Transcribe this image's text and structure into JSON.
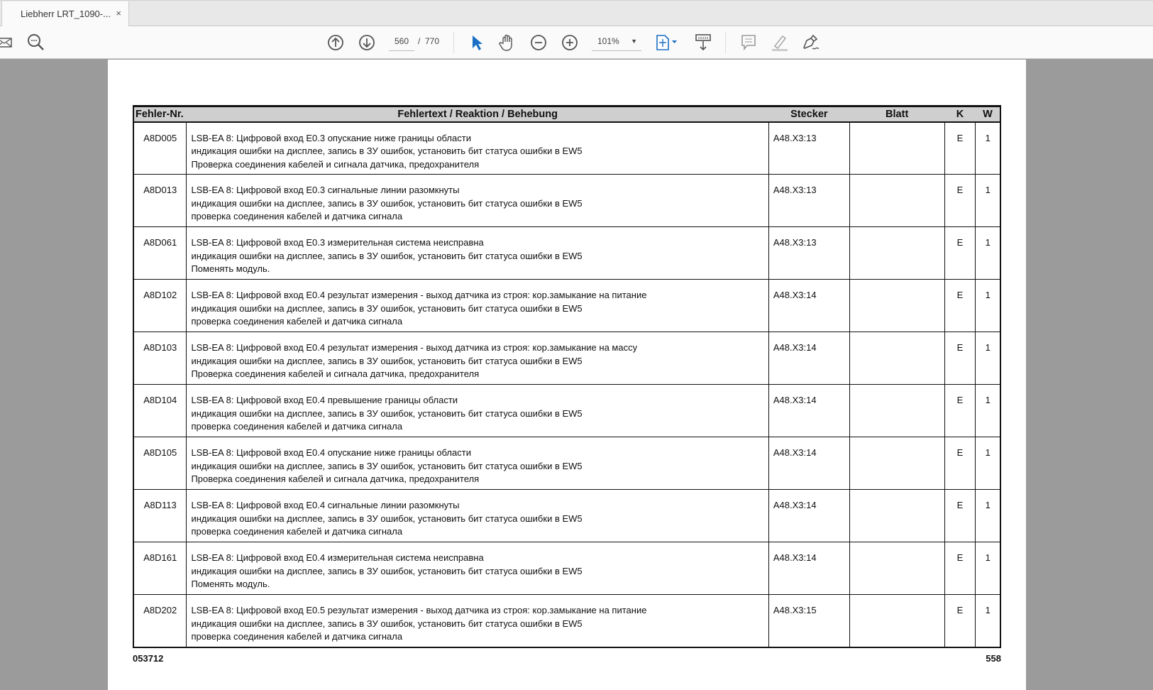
{
  "tab": {
    "title": "Liebherr LRT_1090-...",
    "close": "×"
  },
  "toolbar": {
    "page_current": "560",
    "page_sep": "/",
    "page_total": "770",
    "zoom": "101%",
    "icons": [
      "mail-icon",
      "search-icon",
      "page-up-icon",
      "page-down-icon",
      "select-cursor-icon",
      "hand-icon",
      "zoom-out-icon",
      "zoom-in-icon",
      "fit-page-icon",
      "scroll-mode-icon",
      "comment-icon",
      "highlight-icon",
      "sign-icon"
    ],
    "accent": "#1a6fc4"
  },
  "table": {
    "headers": [
      "Fehler-Nr.",
      "Fehlertext / Reaktion / Behebung",
      "Stecker",
      "Blatt",
      "K",
      "W"
    ],
    "rows": [
      {
        "code": "A8D005",
        "lines": [
          "LSB-EA 8: Цифровой вход E0.3 опускание ниже границы области",
          "индикация ошибки на дисплее, запись в ЗУ ошибок, установить бит статуса ошибки в EW5",
          "Проверка соединения кабелей и сигнала датчика, предохранителя"
        ],
        "stecker": "A48.X3:13",
        "blatt": "",
        "k": "E",
        "w": "1"
      },
      {
        "code": "A8D013",
        "lines": [
          "LSB-EA 8: Цифровой вход E0.3 сигнальные линии разомкнуты",
          "индикация ошибки на дисплее, запись в ЗУ ошибок, установить бит статуса ошибки в EW5",
          "проверка соединения кабелей и датчика сигнала"
        ],
        "stecker": "A48.X3:13",
        "blatt": "",
        "k": "E",
        "w": "1"
      },
      {
        "code": "A8D061",
        "lines": [
          "LSB-EA 8: Цифровой вход E0.3 измерительная система неисправна",
          "индикация ошибки на дисплее, запись в ЗУ ошибок, установить бит статуса ошибки в EW5",
          "Поменять модуль."
        ],
        "stecker": "A48.X3:13",
        "blatt": "",
        "k": "E",
        "w": "1"
      },
      {
        "code": "A8D102",
        "lines": [
          "LSB-EA 8: Цифровой вход E0.4 результат измерения - выход датчика из строя: кор.замыкание на питание",
          "индикация ошибки на дисплее, запись в ЗУ ошибок, установить бит статуса ошибки в EW5",
          "проверка соединения кабелей и датчика сигнала"
        ],
        "stecker": "A48.X3:14",
        "blatt": "",
        "k": "E",
        "w": "1"
      },
      {
        "code": "A8D103",
        "lines": [
          "LSB-EA 8: Цифровой вход E0.4 результат измерения - выход датчика из строя: кор.замыкание на массу",
          "индикация ошибки на дисплее, запись в ЗУ ошибок, установить бит статуса ошибки в EW5",
          "Проверка соединения кабелей и сигнала датчика, предохранителя"
        ],
        "stecker": "A48.X3:14",
        "blatt": "",
        "k": "E",
        "w": "1"
      },
      {
        "code": "A8D104",
        "lines": [
          "LSB-EA 8: Цифровой вход E0.4 превышение границы области",
          "индикация ошибки на дисплее, запись в ЗУ ошибок, установить бит статуса ошибки в EW5",
          "проверка соединения кабелей и датчика сигнала"
        ],
        "stecker": "A48.X3:14",
        "blatt": "",
        "k": "E",
        "w": "1"
      },
      {
        "code": "A8D105",
        "lines": [
          "LSB-EA 8: Цифровой вход E0.4 опускание ниже границы области",
          "индикация ошибки на дисплее, запись в ЗУ ошибок, установить бит статуса ошибки в EW5",
          "Проверка соединения кабелей и сигнала датчика, предохранителя"
        ],
        "stecker": "A48.X3:14",
        "blatt": "",
        "k": "E",
        "w": "1"
      },
      {
        "code": "A8D113",
        "lines": [
          "LSB-EA 8: Цифровой вход E0.4 сигнальные линии разомкнуты",
          "индикация ошибки на дисплее, запись в ЗУ ошибок, установить бит статуса ошибки в EW5",
          "проверка соединения кабелей и датчика сигнала"
        ],
        "stecker": "A48.X3:14",
        "blatt": "",
        "k": "E",
        "w": "1"
      },
      {
        "code": "A8D161",
        "lines": [
          "LSB-EA 8: Цифровой вход E0.4 измерительная система неисправна",
          "индикация ошибки на дисплее, запись в ЗУ ошибок, установить бит статуса ошибки в EW5",
          "Поменять модуль."
        ],
        "stecker": "A48.X3:14",
        "blatt": "",
        "k": "E",
        "w": "1"
      },
      {
        "code": "A8D202",
        "lines": [
          "LSB-EA 8: Цифровой вход E0.5 результат измерения - выход датчика из строя: кор.замыкание на питание",
          "индикация ошибки на дисплее, запись в ЗУ ошибок, установить бит статуса ошибки в EW5",
          "проверка соединения кабелей и датчика сигнала"
        ],
        "stecker": "A48.X3:15",
        "blatt": "",
        "k": "E",
        "w": "1"
      }
    ]
  },
  "footer": {
    "left": "053712",
    "right": "558"
  }
}
